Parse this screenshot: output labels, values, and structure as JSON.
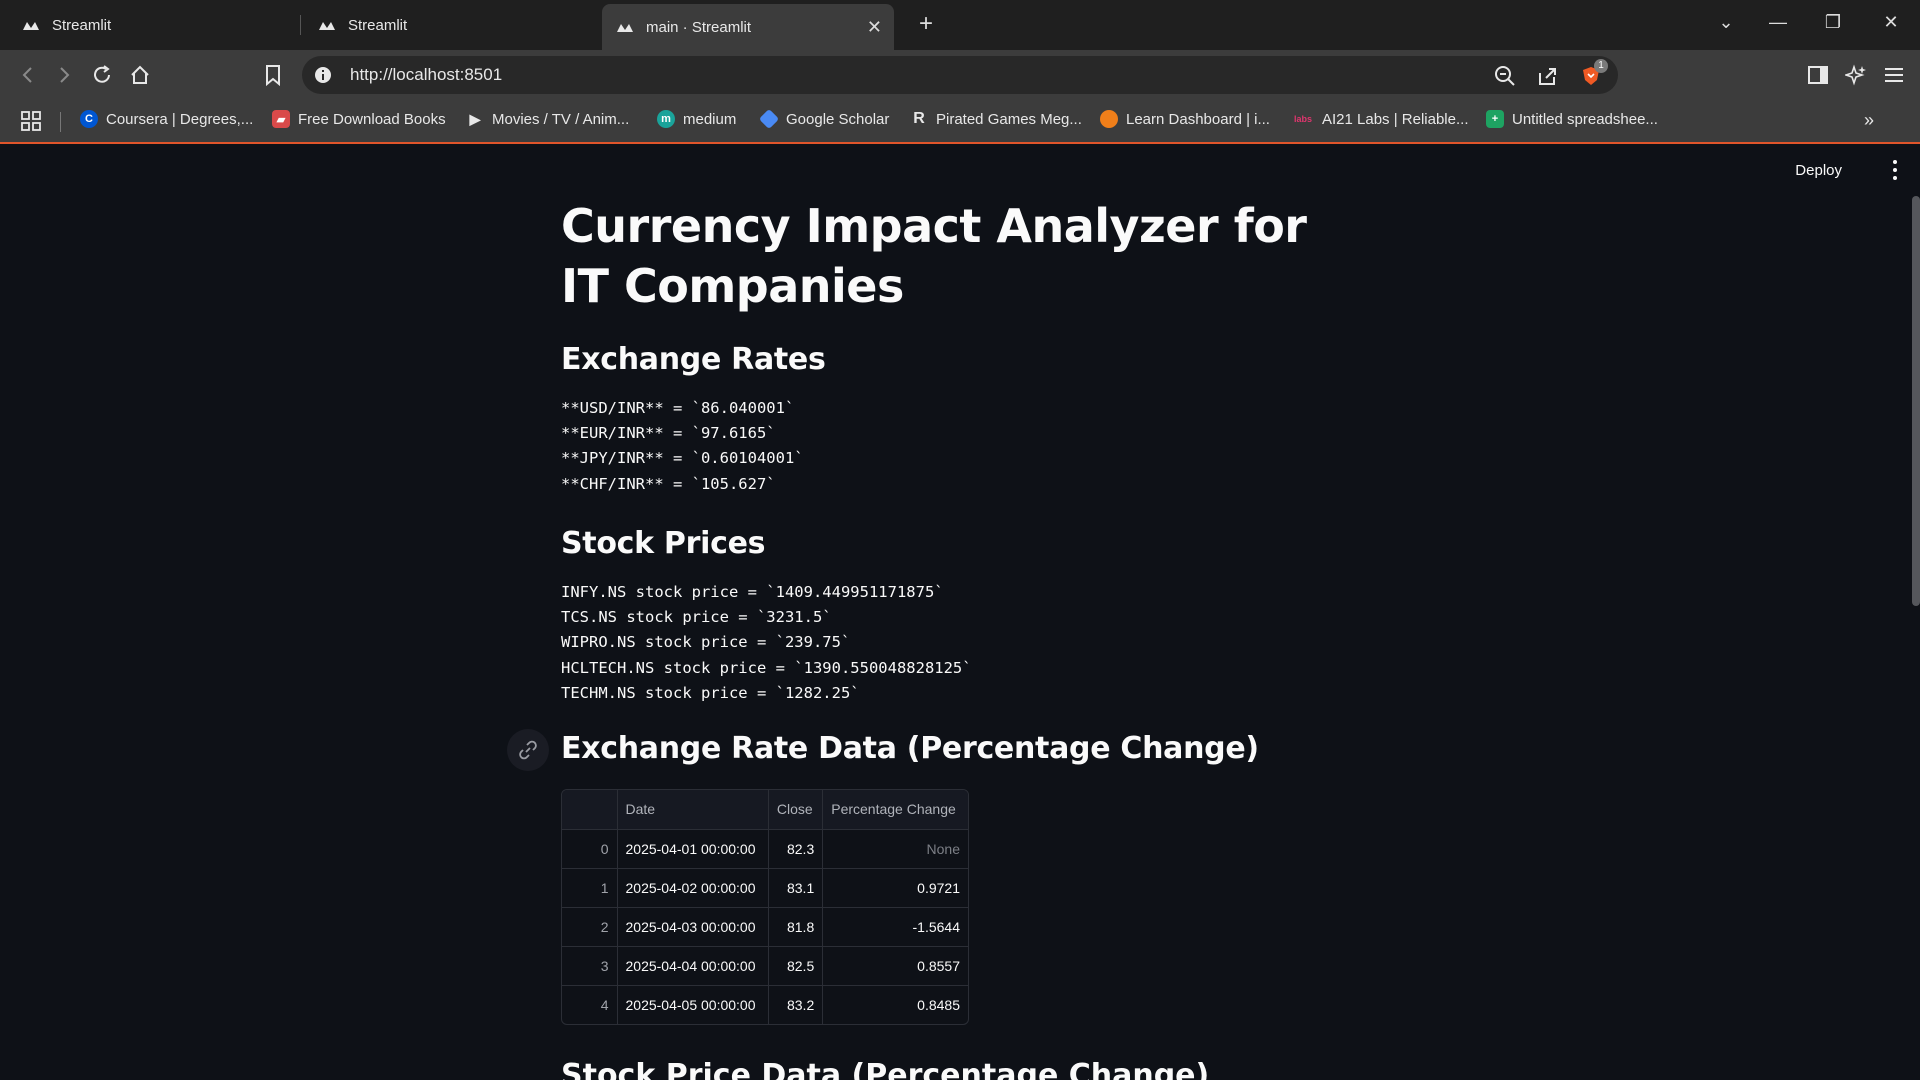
{
  "browser": {
    "tabs": [
      {
        "title": "Streamlit"
      },
      {
        "title": "Streamlit"
      },
      {
        "title": "main · Streamlit"
      }
    ],
    "url": "http://localhost:8501",
    "shield_badge": "1",
    "bookmarks": [
      {
        "label": "Coursera | Degrees,...",
        "icon": "coursera-icon",
        "color": "#0056d2"
      },
      {
        "label": "Free Download Books",
        "icon": "book-icon",
        "color": "#d94a4a"
      },
      {
        "label": "Movies / TV / Anim...",
        "icon": "play-icon",
        "color": "#e8e8e8"
      },
      {
        "label": "medium",
        "icon": "medium-icon",
        "color": "#1aa39a"
      },
      {
        "label": "Google Scholar",
        "icon": "scholar-icon",
        "color": "#4a8af4"
      },
      {
        "label": "Pirated Games Meg...",
        "icon": "r-icon",
        "color": "#e8e8e8"
      },
      {
        "label": "Learn Dashboard | i...",
        "icon": "learn-icon",
        "color": "#f07f1a"
      },
      {
        "label": "AI21 Labs | Reliable...",
        "icon": "ai21-icon",
        "color": "#e0356e"
      },
      {
        "label": "Untitled spreadshee...",
        "icon": "sheets-icon",
        "color": "#1ea362"
      }
    ]
  },
  "app": {
    "deploy_label": "Deploy",
    "title": "Currency Impact Analyzer for IT Companies",
    "exchange_heading": "Exchange Rates",
    "exchange_lines": [
      "**USD/INR** = `86.040001`",
      "**EUR/INR** = `97.6165`",
      "**JPY/INR** = `0.60104001`",
      "**CHF/INR** = `105.627`"
    ],
    "stock_heading": "Stock Prices",
    "stock_lines": [
      "INFY.NS stock price = `1409.449951171875`",
      "TCS.NS stock price = `3231.5`",
      "WIPRO.NS stock price = `239.75`",
      "HCLTECH.NS stock price = `1390.550048828125`",
      "TECHM.NS stock price = `1282.25`"
    ],
    "exchange_data_heading": "Exchange Rate Data (Percentage Change)",
    "table": {
      "columns": [
        "",
        "Date",
        "Close",
        "Percentage Change"
      ],
      "rows": [
        [
          "0",
          "2025-04-01 00:00:00",
          "82.3",
          "None"
        ],
        [
          "1",
          "2025-04-02 00:00:00",
          "83.1",
          "0.9721"
        ],
        [
          "2",
          "2025-04-03 00:00:00",
          "81.8",
          "-1.5644"
        ],
        [
          "3",
          "2025-04-04 00:00:00",
          "82.5",
          "0.8557"
        ],
        [
          "4",
          "2025-04-05 00:00:00",
          "83.2",
          "0.8485"
        ]
      ]
    },
    "next_heading": "Stock Price Data (Percentage Change)"
  }
}
